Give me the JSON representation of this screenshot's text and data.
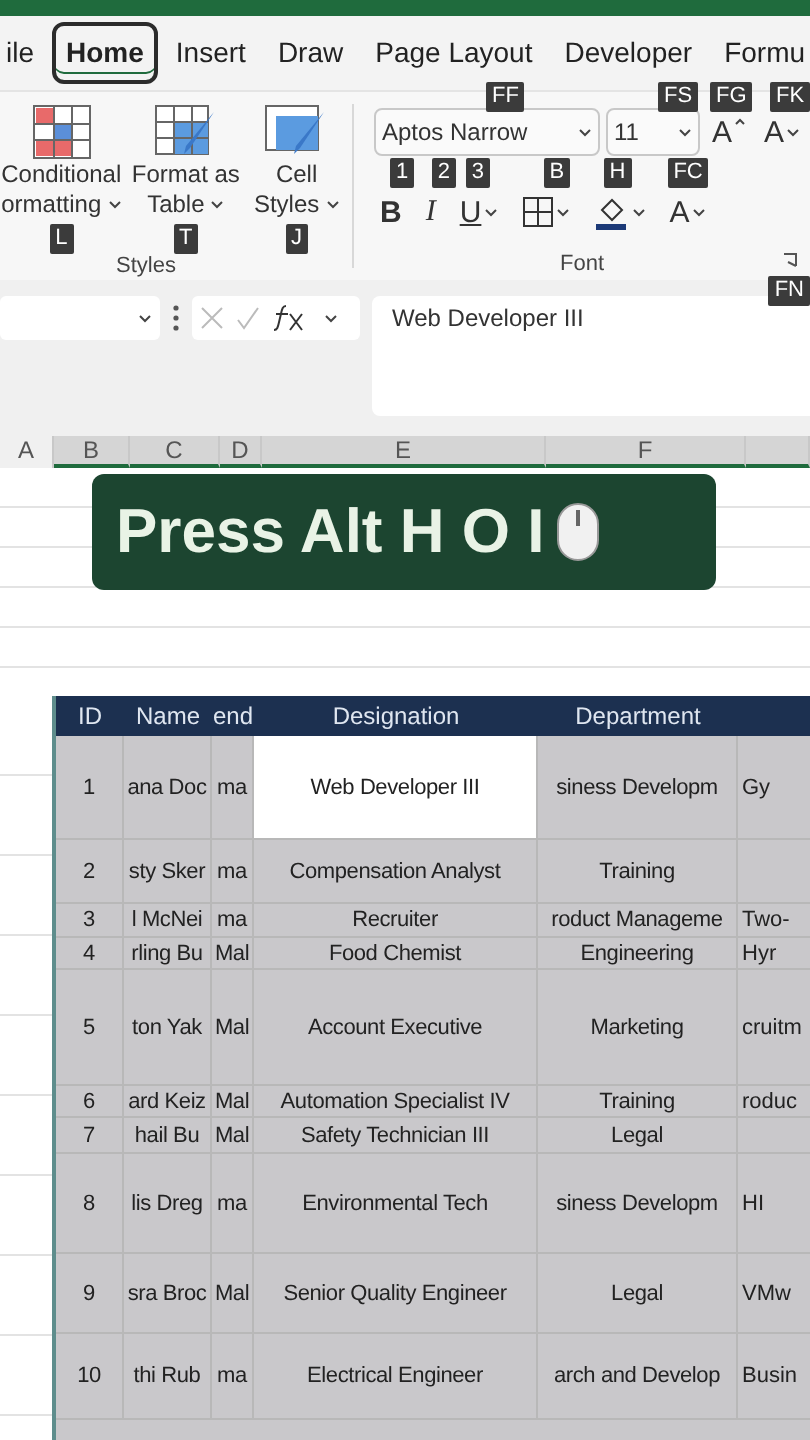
{
  "ribbon_tabs": [
    {
      "label": "ile",
      "selected": false
    },
    {
      "label": "Home",
      "selected": true
    },
    {
      "label": "Insert",
      "selected": false
    },
    {
      "label": "Draw",
      "selected": false
    },
    {
      "label": "Page Layout",
      "selected": false
    },
    {
      "label": "Developer",
      "selected": false
    },
    {
      "label": "Formu",
      "selected": false
    }
  ],
  "styles_group": {
    "label": "Styles",
    "buttons": [
      {
        "kind": "conditional",
        "lines": [
          "Conditional",
          "ormatting"
        ],
        "keytip": "L"
      },
      {
        "kind": "table",
        "lines": [
          "Format as",
          "Table"
        ],
        "keytip": "T"
      },
      {
        "kind": "cell",
        "lines": [
          "Cell",
          "Styles"
        ],
        "keytip": "J"
      }
    ]
  },
  "font_group": {
    "label": "Font",
    "font_name": {
      "value": "Aptos Narrow",
      "keytip": "FF"
    },
    "font_size": {
      "value": "11",
      "keytip": "FS"
    },
    "grow_font": {
      "label": "A",
      "keytip": "FG"
    },
    "shrink_font": {
      "label": "A",
      "keytip": "FK"
    },
    "bold": {
      "label": "B",
      "keytip": "1"
    },
    "italic": {
      "label": "I",
      "keytip": "2"
    },
    "underline": {
      "label": "U",
      "keytip": "3"
    },
    "borders_keytip": "B",
    "fill_color_keytip": "H",
    "font_color": {
      "label": "A",
      "keytip": "FC"
    },
    "launcher_keytip": "FN"
  },
  "formula_bar": {
    "value": "Web Developer III"
  },
  "column_headers": [
    "A",
    "B",
    "C",
    "D",
    "E",
    "F"
  ],
  "banner": {
    "text": "Press Alt H O I"
  },
  "table": {
    "columns": [
      "ID",
      "Name",
      "end",
      "Designation",
      "Department"
    ],
    "rows": [
      {
        "cells": [
          {
            "text": "1",
            "selected": false
          },
          {
            "text": "ana Doc",
            "selected": false
          },
          {
            "text": "ma",
            "selected": false
          },
          {
            "text": "Web Developer III",
            "selected": true
          },
          {
            "text": "siness Developm",
            "selected": false
          }
        ],
        "column_6": "Gy"
      },
      {
        "cells": [
          {
            "text": "2",
            "selected": false
          },
          {
            "text": "sty Sker",
            "selected": false
          },
          {
            "text": "ma",
            "selected": false
          },
          {
            "text": "Compensation Analyst",
            "selected": false
          },
          {
            "text": "Training",
            "selected": false
          }
        ]
      },
      {
        "cells": [
          {
            "text": "3",
            "selected": false
          },
          {
            "text": "l McNei",
            "selected": false
          },
          {
            "text": "ma",
            "selected": false
          },
          {
            "text": "Recruiter",
            "selected": false
          },
          {
            "text": "roduct Manageme",
            "selected": false
          }
        ],
        "column_6": "Two-"
      },
      {
        "cells": [
          {
            "text": "4",
            "selected": false
          },
          {
            "text": "rling Bu",
            "selected": false
          },
          {
            "text": "Mal",
            "selected": false
          },
          {
            "text": "Food Chemist",
            "selected": false
          },
          {
            "text": "Engineering",
            "selected": false
          }
        ],
        "column_6": "Hyr"
      },
      {
        "cells": [
          {
            "text": "5",
            "selected": false
          },
          {
            "text": "ton Yak",
            "selected": false
          },
          {
            "text": "Mal",
            "selected": false
          },
          {
            "text": "Account Executive",
            "selected": false
          },
          {
            "text": "Marketing",
            "selected": false
          }
        ],
        "column_6": "cruitm"
      },
      {
        "cells": [
          {
            "text": "6",
            "selected": false
          },
          {
            "text": "ard Keiz",
            "selected": false
          },
          {
            "text": "Mal",
            "selected": false
          },
          {
            "text": "Automation Specialist IV",
            "selected": false
          },
          {
            "text": "Training",
            "selected": false
          }
        ],
        "column_6": "roduc"
      },
      {
        "cells": [
          {
            "text": "7",
            "selected": false
          },
          {
            "text": "hail Bu",
            "selected": false
          },
          {
            "text": "Mal",
            "selected": false
          },
          {
            "text": "Safety Technician III",
            "selected": false
          },
          {
            "text": "Legal",
            "selected": false
          }
        ]
      },
      {
        "cells": [
          {
            "text": "8",
            "selected": false
          },
          {
            "text": "lis Dreg",
            "selected": false
          },
          {
            "text": "ma",
            "selected": false
          },
          {
            "text": "Environmental Tech",
            "selected": false
          },
          {
            "text": "siness Developm",
            "selected": false
          }
        ],
        "column_6": "HI"
      },
      {
        "cells": [
          {
            "text": "9",
            "selected": false
          },
          {
            "text": "sra Broc",
            "selected": false
          },
          {
            "text": "Mal",
            "selected": false
          },
          {
            "text": "Senior Quality Engineer",
            "selected": false
          },
          {
            "text": "Legal",
            "selected": false
          }
        ],
        "column_6": "VMw"
      },
      {
        "cells": [
          {
            "text": "10",
            "selected": false
          },
          {
            "text": "thi Rub",
            "selected": false
          },
          {
            "text": "ma",
            "selected": false
          },
          {
            "text": "Electrical Engineer",
            "selected": false
          },
          {
            "text": "arch and Develop",
            "selected": false
          }
        ],
        "column_6": "Busin"
      }
    ]
  }
}
